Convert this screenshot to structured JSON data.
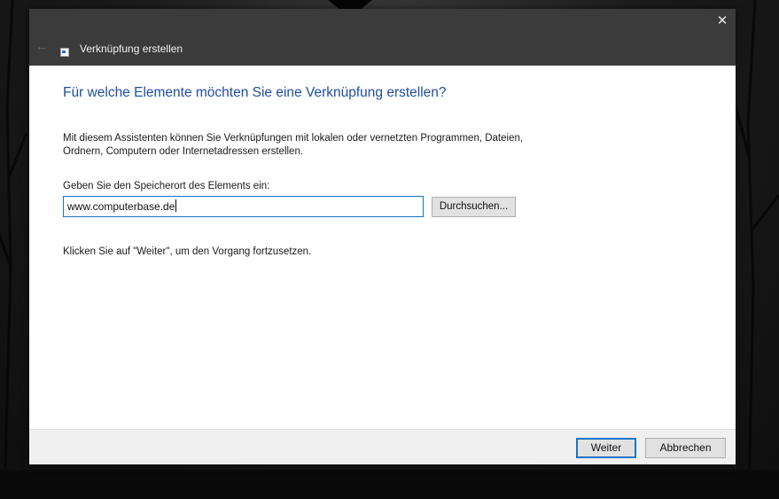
{
  "window": {
    "title": "Verknüpfung erstellen",
    "close_glyph": "✕",
    "back_glyph": "←"
  },
  "content": {
    "heading": "Für welche Elemente möchten Sie eine Verknüpfung erstellen?",
    "description_line1": "Mit diesem Assistenten können Sie Verknüpfungen mit lokalen oder vernetzten Programmen, Dateien,",
    "description_line2": "Ordnern, Computern oder Internetadressen erstellen.",
    "location_label": "Geben Sie den Speicherort des Elements ein:",
    "location_value": "www.computerbase.de",
    "browse_label": "Durchsuchen...",
    "hint": "Klicken Sie auf \"Weiter\", um den Vorgang fortzusetzen."
  },
  "footer": {
    "next_label": "Weiter",
    "cancel_label": "Abbrechen"
  },
  "colors": {
    "heading": "#1f4ea1",
    "titlebar": "#3b3b3b",
    "accent": "#1a73c6"
  },
  "icons": {
    "close": "close-icon",
    "back": "back-arrow-icon",
    "wizard": "shortcut-wizard-icon"
  }
}
